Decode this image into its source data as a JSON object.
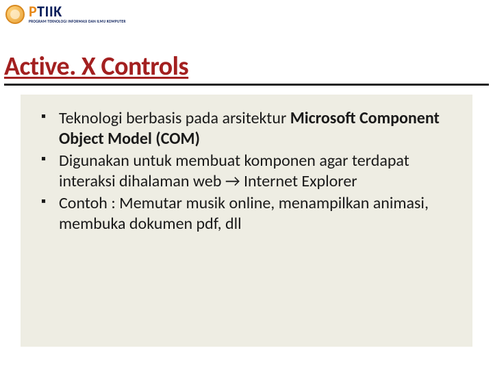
{
  "logo": {
    "main_orange": "P",
    "main_navy": "TIIK",
    "sub": "PROGRAM TEKNOLOGI INFORMASI DAN ILMU KOMPUTER"
  },
  "title": "Active. X Controls",
  "bullets": [
    {
      "pre": "Teknologi berbasis pada arsitektur ",
      "bold": "Microsoft Component Object Model (COM)",
      "post": ""
    },
    {
      "pre": "Digunakan untuk membuat komponen agar terdapat interaksi dihalaman web → Internet Explorer",
      "bold": "",
      "post": ""
    },
    {
      "pre": "Contoh : Memutar musik online, menampilkan animasi, membuka dokumen pdf, dll",
      "bold": "",
      "post": ""
    }
  ]
}
